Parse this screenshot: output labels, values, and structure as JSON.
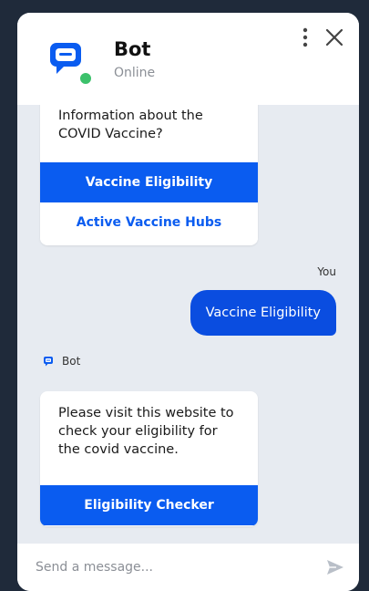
{
  "header": {
    "title": "Bot",
    "status": "Online",
    "status_color": "#3cc16b",
    "brand_color": "#0a5cf0"
  },
  "messages": {
    "card1": {
      "text": "Information about the COVID Vaccine?",
      "primary_button": "Vaccine Eligibility",
      "secondary_button": "Active Vaccine Hubs"
    },
    "you_label": "You",
    "user_message": "Vaccine Eligibility",
    "bot_label": "Bot",
    "card2": {
      "text": "Please visit this website to check your eligibility for the covid vaccine.",
      "primary_button": "Eligibility Checker"
    }
  },
  "composer": {
    "placeholder": "Send a message..."
  },
  "icons": {
    "avatar": "chat-bubble-icon",
    "more": "more-vertical-icon",
    "close": "close-icon",
    "send": "send-icon"
  }
}
